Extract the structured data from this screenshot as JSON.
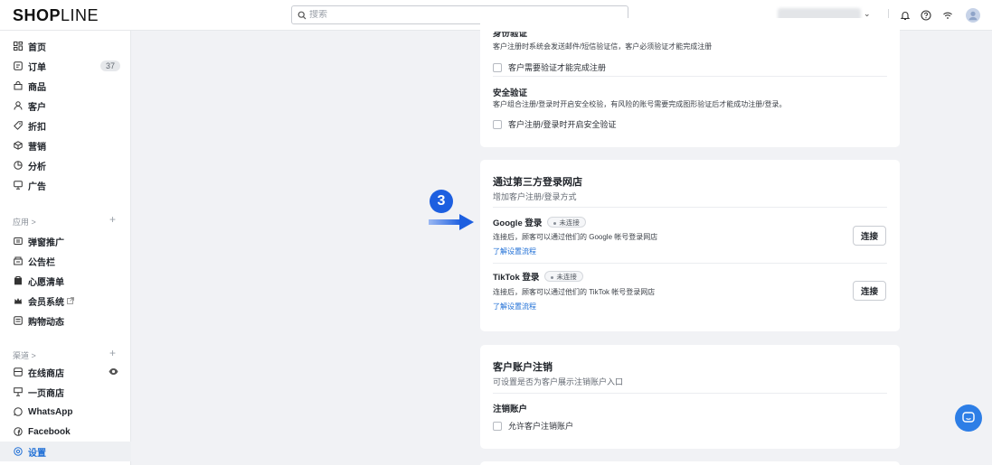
{
  "brand": {
    "logo_bold": "SHOP",
    "logo_thin": "LINE"
  },
  "search": {
    "placeholder": "搜索"
  },
  "sidebar": {
    "main_items": [
      {
        "label": "首页",
        "icon": "home-grid-icon"
      },
      {
        "label": "订单",
        "icon": "order-icon",
        "badge": "37"
      },
      {
        "label": "商品",
        "icon": "product-bag-icon"
      },
      {
        "label": "客户",
        "icon": "customer-icon"
      },
      {
        "label": "折扣",
        "icon": "discount-tag-icon"
      },
      {
        "label": "营销",
        "icon": "marketing-icon"
      },
      {
        "label": "分析",
        "icon": "analytics-icon"
      },
      {
        "label": "广告",
        "icon": "ads-icon"
      }
    ],
    "apps_title": "应用 >",
    "app_items": [
      {
        "label": "弹窗推广",
        "icon": "popup-icon"
      },
      {
        "label": "公告栏",
        "icon": "announcement-icon"
      },
      {
        "label": "心愿清单",
        "icon": "wishlist-icon"
      },
      {
        "label": "会员系统",
        "icon": "membership-icon"
      },
      {
        "label": "购物动态",
        "icon": "shopping-feed-icon"
      }
    ],
    "channels_title": "渠道 >",
    "channel_items": [
      {
        "label": "在线商店",
        "icon": "online-store-icon"
      },
      {
        "label": "一页商店",
        "icon": "one-page-store-icon"
      },
      {
        "label": "WhatsApp",
        "icon": "whatsapp-icon"
      },
      {
        "label": "Facebook",
        "icon": "facebook-icon"
      },
      {
        "label": "设置",
        "icon": "settings-icon",
        "active": true
      }
    ]
  },
  "verification_card": {
    "identity_title_partial": "身份验证",
    "identity_desc": "客户注册时系统会发送邮件/短信验证信，客户必须验证才能完成注册",
    "identity_checkbox": "客户需要验证才能完成注册",
    "security_title": "安全验证",
    "security_desc": "客户组合注册/登录时开启安全校验，有风险的账号需要完成图形验证后才能成功注册/登录。",
    "security_checkbox": "客户注册/登录时开启安全验证"
  },
  "third_party_card": {
    "title": "通过第三方登录网店",
    "subtitle": "增加客户注册/登录方式",
    "google": {
      "title": "Google 登录",
      "status": "未连接",
      "desc": "连接后，顾客可以通过他们的 Google 帐号登录网店",
      "link": "了解设置流程",
      "button": "连接"
    },
    "tiktok": {
      "title": "TikTok 登录",
      "status": "未连接",
      "desc": "连接后，顾客可以通过他们的 TikTok 帐号登录网店",
      "link": "了解设置流程",
      "button": "连接"
    }
  },
  "cancel_card": {
    "title": "客户账户注销",
    "subtitle": "可设置是否为客户展示注销账户入口",
    "row_title": "注销账户",
    "checkbox": "允许客户注销账户"
  },
  "annotation": {
    "step": "3"
  },
  "colors": {
    "accent": "#1f6fd6",
    "annotation": "#1d5fe0",
    "page_bg": "#f1f2f5"
  }
}
